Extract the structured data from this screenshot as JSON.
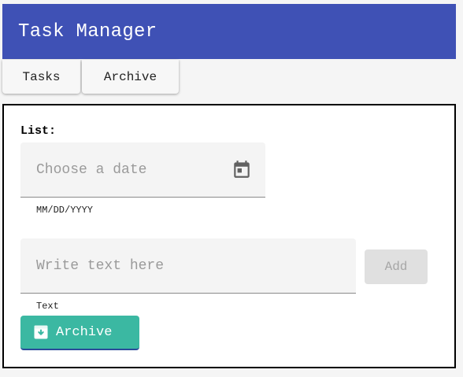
{
  "header": {
    "title": "Task Manager"
  },
  "tabs": [
    {
      "label": "Tasks"
    },
    {
      "label": "Archive"
    }
  ],
  "panel": {
    "list_label": "List:",
    "date_field": {
      "placeholder": "Choose a date",
      "value": "",
      "hint": "MM/DD/YYYY",
      "icon": "calendar-icon"
    },
    "text_field": {
      "placeholder": "Write text here",
      "value": "",
      "hint": "Text"
    },
    "add_button": {
      "label": "Add",
      "disabled": true
    },
    "archive_button": {
      "label": "Archive",
      "icon": "archive-icon"
    }
  },
  "colors": {
    "header_bg": "#3f51b5",
    "archive_button_bg": "#3bb8a2",
    "add_button_bg": "#e0e0e0"
  }
}
